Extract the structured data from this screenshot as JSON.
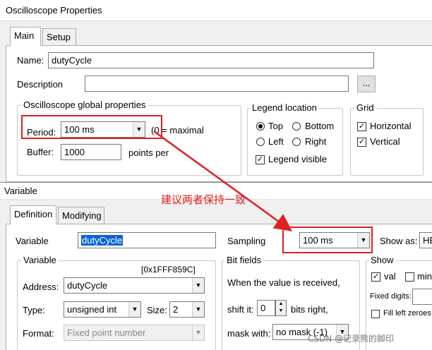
{
  "osc": {
    "title": "Oscilloscope Properties",
    "tabs": [
      "Main",
      "Setup"
    ],
    "name_label": "Name:",
    "name_value": "dutyCycle",
    "description_label": "Description",
    "description_value": "",
    "browse_label": "...",
    "global_group": "Oscilloscope global properties",
    "period_label": "Period:",
    "period_value": "100 ms",
    "period_hint": "(0 = maximal",
    "buffer_label": "Buffer:",
    "buffer_value": "1000",
    "buffer_unit": "points per",
    "legend_group": "Legend location",
    "legend_top": "Top",
    "legend_bottom": "Bottom",
    "legend_left": "Left",
    "legend_right": "Right",
    "legend_visible": "Legend visible",
    "legend_selected": "Top",
    "legend_visible_checked": true,
    "grid_group": "Grid",
    "grid_horizontal": "Horizontal",
    "grid_vertical": "Vertical",
    "grid_horizontal_checked": true,
    "grid_vertical_checked": true
  },
  "var": {
    "title": "Variable",
    "tabs": [
      "Definition",
      "Modifying"
    ],
    "variable_label": "Variable",
    "variable_value": "dutyCycle",
    "sampling_label": "Sampling",
    "sampling_value": "100 ms",
    "showas_label": "Show as:",
    "showas_value": "HE",
    "variable_group": "Variable",
    "address_hex": "[0x1FFF859C]",
    "address_label": "Address:",
    "address_value": "dutyCycle",
    "type_label": "Type:",
    "type_value": "unsigned int",
    "size_label": "Size:",
    "size_value": "2",
    "format_label": "Format:",
    "format_value": "Fixed point number",
    "bitfields_group": "Bit fields",
    "bitfields_text": "When the value is received,",
    "shift_label": "shift it:",
    "shift_value": "0",
    "shift_suffix": "bits right,",
    "mask_label": "mask with:",
    "mask_value": "no mask (-1)",
    "show_group": "Show",
    "val_label": "val",
    "val_checked": true,
    "min_label": "min",
    "min_checked": false,
    "fixed_digits_label": "Fixed digits:",
    "fill_left_label": "Fill left zeroes",
    "fill_left_checked": false
  },
  "annotation": {
    "text": "建议两者保持一致",
    "color": "#e02020"
  },
  "watermark": "CSDN @记录熊的脚印"
}
